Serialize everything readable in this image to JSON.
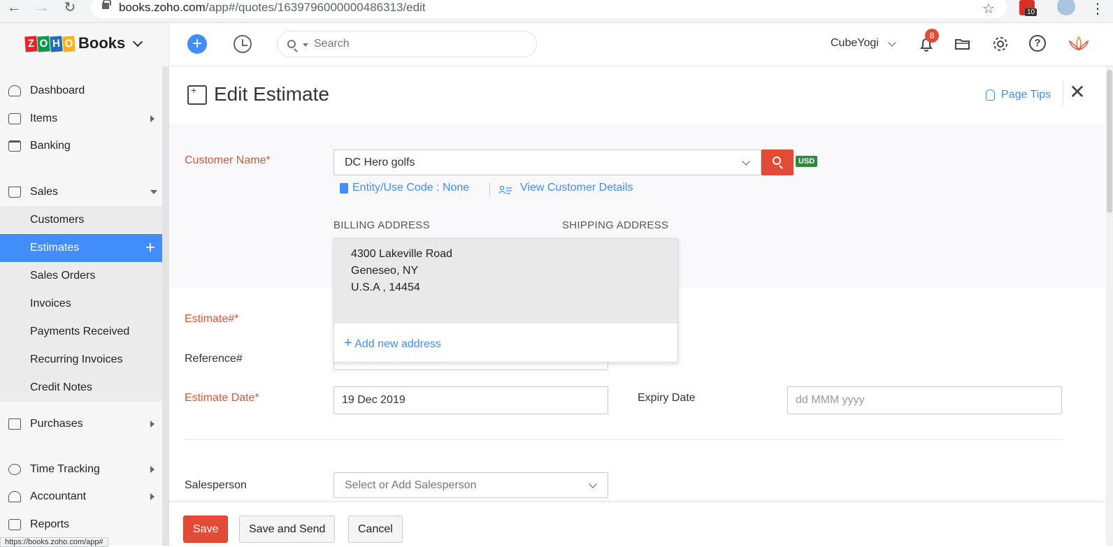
{
  "browser": {
    "url_host": "books.zoho.com",
    "url_path": "/app#/quotes/1639796000000486313/edit",
    "extension_badge": "10",
    "status_url": "https://books.zoho.com/app#"
  },
  "header": {
    "logo_letters": [
      "Z",
      "O",
      "H",
      "O"
    ],
    "logo_colors": [
      "#e42527",
      "#089949",
      "#226db4",
      "#f9b21d"
    ],
    "brand": "Books",
    "search_placeholder": "Search",
    "org_name": "CubeYogi",
    "notification_count": "8",
    "icons": [
      "add-icon",
      "history-icon",
      "search-icon",
      "bell-icon",
      "folder-icon",
      "gear-icon",
      "help-icon",
      "lotus-icon"
    ]
  },
  "sidebar": {
    "items": [
      {
        "label": "Dashboard",
        "icon": "dashboard-icon"
      },
      {
        "label": "Items",
        "icon": "basket-icon"
      },
      {
        "label": "Banking",
        "icon": "bank-icon"
      },
      {
        "label": "Sales",
        "icon": "cart-icon"
      },
      {
        "label": "Customers"
      },
      {
        "label": "Estimates"
      },
      {
        "label": "Sales Orders"
      },
      {
        "label": "Invoices"
      },
      {
        "label": "Payments Received"
      },
      {
        "label": "Recurring Invoices"
      },
      {
        "label": "Credit Notes"
      },
      {
        "label": "Purchases",
        "icon": "bag-icon"
      },
      {
        "label": "Time Tracking",
        "icon": "timer-icon"
      },
      {
        "label": "Accountant",
        "icon": "accountant-icon"
      },
      {
        "label": "Reports",
        "icon": "reports-icon"
      }
    ]
  },
  "page": {
    "title": "Edit Estimate",
    "page_tips": "Page Tips"
  },
  "form": {
    "customer_label": "Customer Name",
    "customer_value": "DC Hero golfs",
    "currency": "USD",
    "entity_link": "Entity/Use Code : None",
    "view_customer_link": "View Customer Details",
    "billing_head": "BILLING ADDRESS",
    "shipping_head": "SHIPPING ADDRESS",
    "address_lines": [
      "4300 Lakeville Road",
      "Geneseo, NY",
      "U.S.A , 14454"
    ],
    "add_address": "Add new address",
    "estimate_label": "Estimate#",
    "reference_label": "Reference#",
    "estimate_date_label": "Estimate Date",
    "estimate_date_value": "19 Dec 2019",
    "expiry_label": "Expiry Date",
    "expiry_placeholder": "dd MMM yyyy",
    "salesperson_label": "Salesperson",
    "salesperson_placeholder": "Select or Add Salesperson",
    "required_mark": "*"
  },
  "footer": {
    "save": "Save",
    "save_send": "Save and Send",
    "cancel": "Cancel"
  },
  "colors": {
    "accent": "#408dfb",
    "danger": "#e24b35",
    "currency_badge": "#2e8b3d"
  }
}
